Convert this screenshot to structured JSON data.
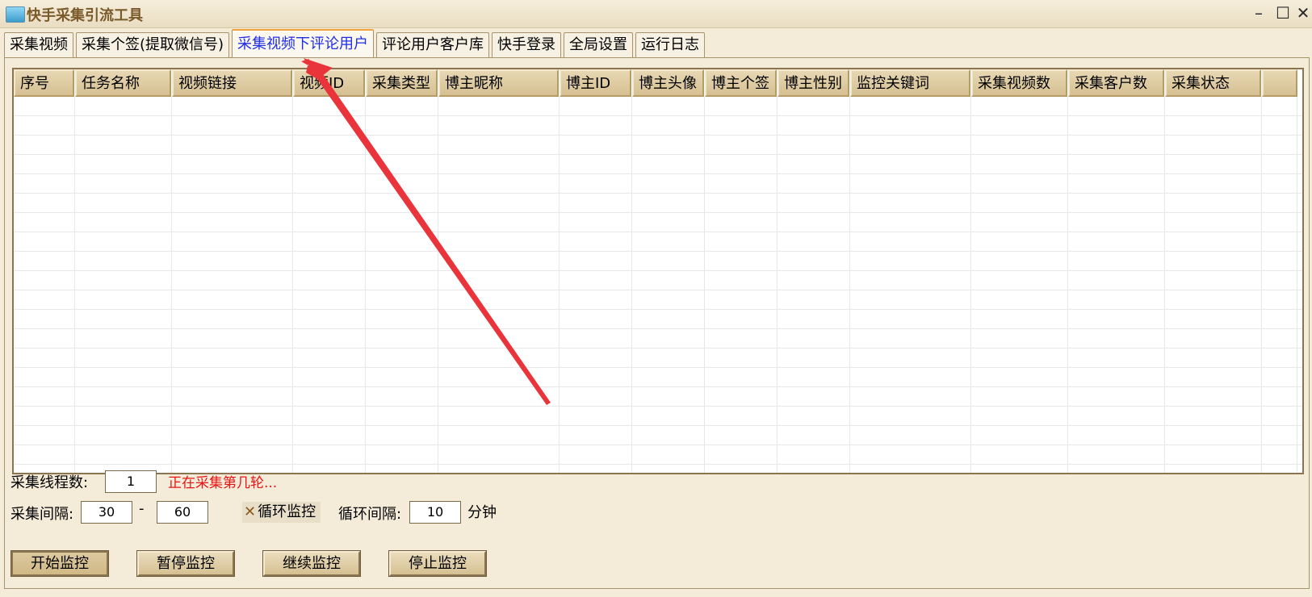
{
  "window": {
    "title": "快手采集引流工具"
  },
  "tabs": [
    {
      "label": "采集视频",
      "active": false
    },
    {
      "label": "采集个签(提取微信号)",
      "active": false
    },
    {
      "label": "采集视频下评论用户",
      "active": true
    },
    {
      "label": "评论用户客户库",
      "active": false
    },
    {
      "label": "快手登录",
      "active": false
    },
    {
      "label": "全局设置",
      "active": false
    },
    {
      "label": "运行日志",
      "active": false
    }
  ],
  "table": {
    "columns": [
      "序号",
      "任务名称",
      "视频链接",
      "视频ID",
      "采集类型",
      "博主昵称",
      "博主ID",
      "博主头像",
      "博主个签",
      "博主性别",
      "监控关键词",
      "采集视频数",
      "采集客户数",
      "采集状态"
    ],
    "rows": []
  },
  "controls": {
    "threads_label": "采集线程数:",
    "threads_value": "1",
    "status_text": "正在采集第几轮...",
    "interval_label": "采集间隔:",
    "interval_min": "30",
    "interval_sep": "-",
    "interval_max": "60",
    "loop_monitor_label": "循环监控",
    "loop_monitor_checked": true,
    "loop_interval_label": "循环间隔:",
    "loop_interval_value": "10",
    "loop_interval_unit": "分钟"
  },
  "buttons": {
    "start": "开始监控",
    "pause": "暂停监控",
    "resume": "继续监控",
    "stop": "停止监控"
  },
  "icons": {
    "minimize": "minimize-icon",
    "maximize": "maximize-icon",
    "close": "close-icon",
    "annotation": "red-arrow-annotation"
  },
  "colors": {
    "active_tab_text": "#1f2ee8",
    "status_text": "#e81414",
    "arrow": "#e8343a"
  }
}
